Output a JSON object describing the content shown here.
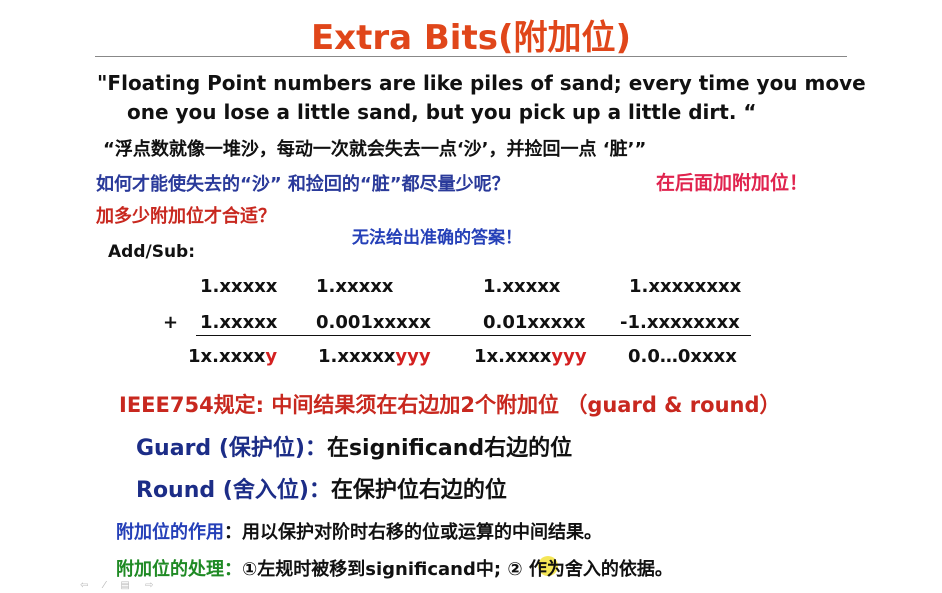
{
  "title": "Extra Bits(附加位)",
  "quote": {
    "line1": "\"Floating Point numbers are like piles of sand; every time you move",
    "line2": "one you lose a little sand, but you pick up a little dirt. “",
    "cn": "“浮点数就像一堆沙，每动一次就会失去一点‘沙’，并捡回一点 ‘脏’”"
  },
  "question": {
    "text": "如何才能使失去的“沙” 和捡回的“脏”都尽量少呢？",
    "answer": "在后面加附加位！",
    "how_many": "加多少附加位才合适？",
    "no_answer": "无法给出准确的答案！"
  },
  "addsub": {
    "label": "Add/Sub:",
    "plus": "+",
    "columns": [
      {
        "top": "1.xxxxx",
        "second": "1.xxxxx",
        "result_black": "1x.xxxx",
        "result_red": "y"
      },
      {
        "top": "1.xxxxx",
        "second": "0.001xxxxx",
        "result_black": "1.xxxxx",
        "result_red": "yyy"
      },
      {
        "top": "1.xxxxx",
        "second": "0.01xxxxx",
        "result_black": "1x.xxxx",
        "result_red": "yyy"
      },
      {
        "top": "1.xxxxxxxx",
        "second": "-1.xxxxxxxx",
        "result_black": "0.0…0xxxx",
        "result_red": ""
      }
    ]
  },
  "ieee": "IEEE754规定: 中间结果须在右边加2个附加位 （guard & round）",
  "guard": {
    "label": "Guard (保护位)：",
    "desc": "在significand右边的位"
  },
  "round": {
    "label": "Round (舍入位)：",
    "desc": "在保护位右边的位"
  },
  "purpose": {
    "label": "附加位的作用",
    "desc": "：用以保护对阶时右移的位或运算的中间结果。"
  },
  "handling": {
    "label": "附加位的处理：",
    "desc": "①左规时被移到significand中; ② 作为舍入的依据。"
  },
  "nav_icons": "⇦ ⁄ ▤ ⇨"
}
